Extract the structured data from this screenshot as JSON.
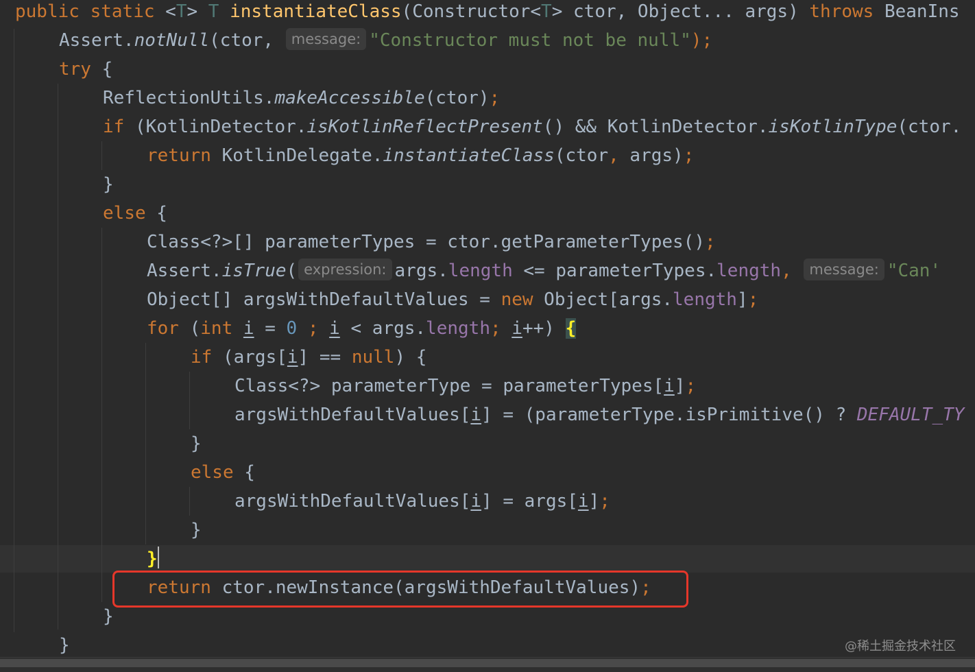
{
  "method_signature": {
    "public_kw": "public",
    "static_kw": "static",
    "type_param_open": "<",
    "type_param": "T",
    "type_param_close": ">",
    "return_type": "T",
    "method_name": "instantiateClass",
    "params_open": "(Constructor<",
    "params_type": "T",
    "params_rest": "> ctor, Object... args)",
    "throws_kw": "throws",
    "exception": "BeanIns"
  },
  "line_assert": {
    "class": "Assert.",
    "method": "notNull",
    "arg": "(ctor, ",
    "hint": "message:",
    "string": "\"Constructor must not be null\"",
    "end": ");"
  },
  "line_try": {
    "kw": "try",
    "brace": " {"
  },
  "line_reflect": {
    "class": "ReflectionUtils.",
    "method": "makeAccessible",
    "args": "(ctor)",
    "semi": ";"
  },
  "line_if_kotlin": {
    "kw": "if",
    "open": " (KotlinDetector.",
    "method1": "isKotlinReflectPresent",
    "mid": "() && KotlinDetector.",
    "method2": "isKotlinType",
    "rest": "(ctor."
  },
  "line_return_kotlin": {
    "kw": "return",
    "class": " KotlinDelegate.",
    "method": "instantiateClass",
    "args": "(ctor",
    "comma": ",",
    "args2": " args)",
    "semi": ";"
  },
  "line_close_if": {
    "text": "}"
  },
  "line_else": {
    "kw": "else",
    "brace": " {"
  },
  "line_param_types": {
    "text": "Class<?>[] parameterTypes = ctor.getParameterTypes()",
    "semi": ";"
  },
  "line_assert_true": {
    "class": "Assert.",
    "method": "isTrue",
    "open": "(",
    "hint1": "expression:",
    "args": "args.",
    "field1": "length",
    "op": " <= parameterTypes.",
    "field2": "length",
    "comma": ",",
    "hint2": "message:",
    "string": "\"Can'"
  },
  "line_args_default": {
    "start": "Object[] argsWithDefaultValues = ",
    "new_kw": "new",
    "mid": " Object[args.",
    "field": "length",
    "end": "]",
    "semi": ";"
  },
  "line_for": {
    "kw": "for",
    "open": " (",
    "int_kw": "int",
    "var": "i",
    "eq": " = ",
    "num": "0",
    "semi1": " ;",
    "var2": "i",
    "cmp": " < args.",
    "field": "length",
    "semi2": ";",
    "var3": "i",
    "incr": "++) ",
    "brace": "{"
  },
  "line_if_null": {
    "kw": "if",
    "open": " (args[",
    "var": "i",
    "cmp": "] == ",
    "null_kw": "null",
    "close": ") {"
  },
  "line_param_type": {
    "text": "Class<?> parameterType = parameterTypes[",
    "var": "i",
    "end": "]",
    "semi": ";"
  },
  "line_args_assign": {
    "text": "argsWithDefaultValues[",
    "var": "i",
    "mid": "] = (parameterType.isPrimitive() ? ",
    "const": "DEFAULT_TY"
  },
  "line_close_if_null": {
    "text": "}"
  },
  "line_else_inner": {
    "kw": "else",
    "brace": " {"
  },
  "line_args_else": {
    "text": "argsWithDefaultValues[",
    "var": "i",
    "mid": "] = args[",
    "var2": "i",
    "end": "]",
    "semi": ";"
  },
  "line_close_else_inner": {
    "text": "}"
  },
  "line_close_for": {
    "brace": "}"
  },
  "line_return_new": {
    "kw": "return",
    "text": " ctor.newInstance(argsWithDefaultValues)",
    "semi": ";"
  },
  "line_close_else": {
    "text": "}"
  },
  "line_close_try": {
    "text": "}"
  },
  "watermark": "@稀土掘金技术社区",
  "colors": {
    "background": "#2b2b2b",
    "keyword": "#cc7832",
    "method_decl": "#ffc66d",
    "string": "#6a8759",
    "field": "#9876aa",
    "number": "#6897bb",
    "default_text": "#a9b7c6",
    "highlight_box": "#e5372a",
    "brace_match": "#ffef28"
  }
}
